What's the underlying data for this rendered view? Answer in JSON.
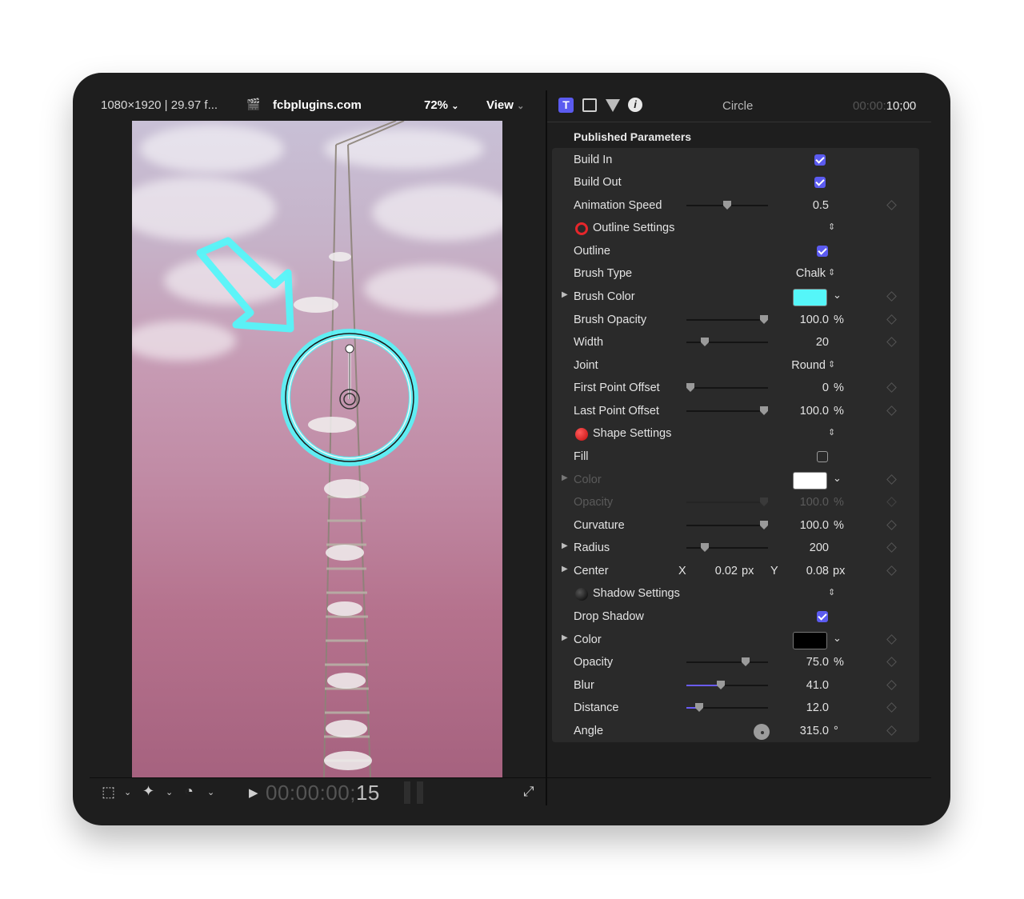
{
  "viewer": {
    "format": "1080×1920 | 29.97 f...",
    "site": "fcbplugins.com",
    "zoom": "72%",
    "view": "View",
    "timecode_dim": "00:00:00;",
    "timecode_bright": "15"
  },
  "inspector": {
    "title": "Circle",
    "duration_dim": "00:00:",
    "duration_bright": "10;00",
    "header": "Published Parameters",
    "rows": {
      "build_in": {
        "label": "Build In",
        "checked": true
      },
      "build_out": {
        "label": "Build Out",
        "checked": true
      },
      "animation_speed": {
        "label": "Animation Speed",
        "value": "0.5",
        "slider": 0.5
      },
      "outline_settings": {
        "label": "Outline Settings",
        "icon": "red-ring-icon"
      },
      "outline": {
        "label": "Outline",
        "checked": true
      },
      "brush_type": {
        "label": "Brush Type",
        "value": "Chalk"
      },
      "brush_color": {
        "label": "Brush Color",
        "color": "#55f6f9"
      },
      "brush_opacity": {
        "label": "Brush Opacity",
        "value": "100.0",
        "unit": "%",
        "slider": 1.0
      },
      "width": {
        "label": "Width",
        "value": "20",
        "slider": 0.2
      },
      "joint": {
        "label": "Joint",
        "value": "Round"
      },
      "first_point_offset": {
        "label": "First Point Offset",
        "value": "0",
        "unit": "%",
        "slider": 0.0
      },
      "last_point_offset": {
        "label": "Last Point Offset",
        "value": "100.0",
        "unit": "%",
        "slider": 1.0
      },
      "shape_settings": {
        "label": "Shape Settings",
        "icon": "red-ball-icon"
      },
      "fill": {
        "label": "Fill",
        "checked": false
      },
      "fill_color": {
        "label": "Color",
        "color": "#ffffff"
      },
      "fill_opacity": {
        "label": "Opacity",
        "value": "100.0",
        "unit": "%"
      },
      "curvature": {
        "label": "Curvature",
        "value": "100.0",
        "unit": "%",
        "slider": 1.0
      },
      "radius": {
        "label": "Radius",
        "value": "200",
        "slider": 0.2
      },
      "center": {
        "label": "Center",
        "x_label": "X",
        "x_value": "0.02",
        "x_unit": "px",
        "y_label": "Y",
        "y_value": "0.08",
        "y_unit": "px"
      },
      "shadow_settings": {
        "label": "Shadow Settings",
        "icon": "black-ball-icon"
      },
      "drop_shadow": {
        "label": "Drop Shadow",
        "checked": true
      },
      "shadow_color": {
        "label": "Color",
        "color": "#000000"
      },
      "shadow_opacity": {
        "label": "Opacity",
        "value": "75.0",
        "unit": "%",
        "slider": 0.75
      },
      "blur": {
        "label": "Blur",
        "value": "41.0",
        "slider": 0.41
      },
      "distance": {
        "label": "Distance",
        "value": "12.0",
        "slider": 0.12
      },
      "angle": {
        "label": "Angle",
        "value": "315.0",
        "unit": "°"
      }
    }
  },
  "colors": {
    "accent": "#5b5bf0",
    "overlay": "#55f6f9"
  }
}
